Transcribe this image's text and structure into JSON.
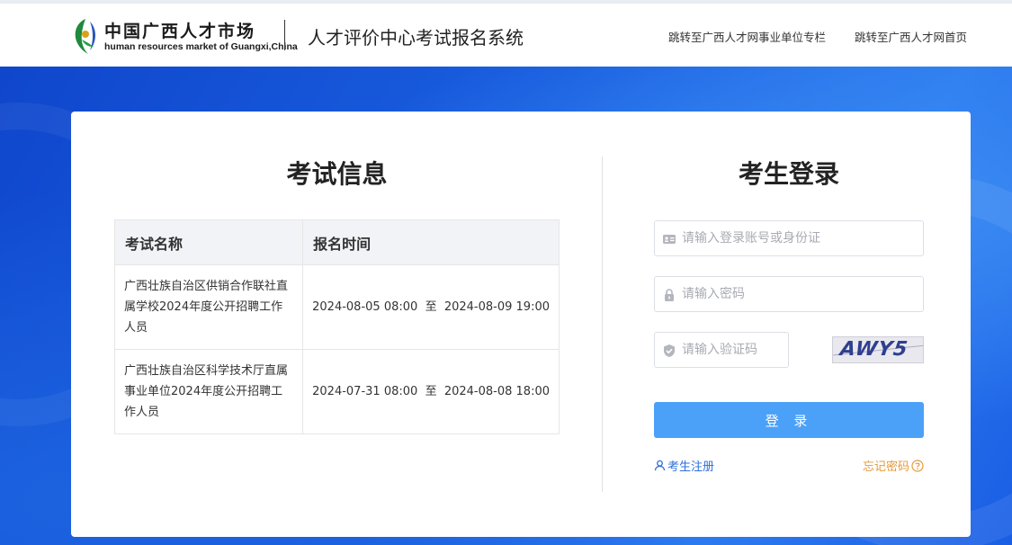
{
  "header": {
    "logo_cn": "中国广西人才市场",
    "logo_en": "human resources market of Guangxi,China",
    "system_title": "人才评价中心考试报名系统",
    "nav": [
      {
        "label": "跳转至广西人才网事业单位专栏"
      },
      {
        "label": "跳转至广西人才网首页"
      }
    ]
  },
  "exam_info": {
    "title": "考试信息",
    "columns": [
      "考试名称",
      "报名时间"
    ],
    "rows": [
      {
        "name": "广西壮族自治区供销合作联社直属学校2024年度公开招聘工作人员",
        "start": "2024-08-05 08:00",
        "sep": "至",
        "end": "2024-08-09 19:00"
      },
      {
        "name": "广西壮族自治区科学技术厅直属事业单位2024年度公开招聘工作人员",
        "start": "2024-07-31 08:00",
        "sep": "至",
        "end": "2024-08-08 18:00"
      }
    ]
  },
  "login": {
    "title": "考生登录",
    "account_placeholder": "请输入登录账号或身份证",
    "password_placeholder": "请输入密码",
    "captcha_placeholder": "请输入验证码",
    "captcha_text": "AWY5",
    "submit_label": "登 录",
    "register_label": "考生注册",
    "forgot_label": "忘记密码"
  },
  "colors": {
    "accent": "#4ba0f8",
    "link": "#2e6fdc",
    "warning_link": "#e59a3a",
    "banner": "#1a5fe0"
  }
}
